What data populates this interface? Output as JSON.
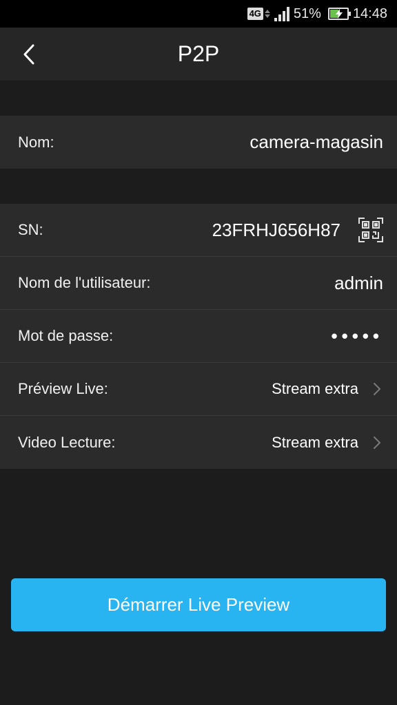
{
  "status_bar": {
    "network": "4G",
    "battery_percent": "51%",
    "battery_level": 0.51,
    "time": "14:48"
  },
  "header": {
    "title": "P2P",
    "back_icon": "chevron-left-icon"
  },
  "device_name": {
    "label": "Nom:",
    "value": "camera-magasin"
  },
  "details": {
    "sn_label": "SN:",
    "sn_value": "23FRHJ656H87",
    "qr_icon": "qr-code-scan-icon",
    "username_label": "Nom de l'utilisateur:",
    "username_value": "admin",
    "password_label": "Mot de passe:",
    "password_value": "•••••",
    "preview_label": "Préview Live:",
    "preview_value": "Stream extra",
    "playback_label": "Video Lecture:",
    "playback_value": "Stream extra"
  },
  "actions": {
    "start_label": "Démarrer Live Preview"
  },
  "colors": {
    "accent": "#28b4f0",
    "background": "#1c1c1c",
    "row_background": "#2b2b2b"
  }
}
